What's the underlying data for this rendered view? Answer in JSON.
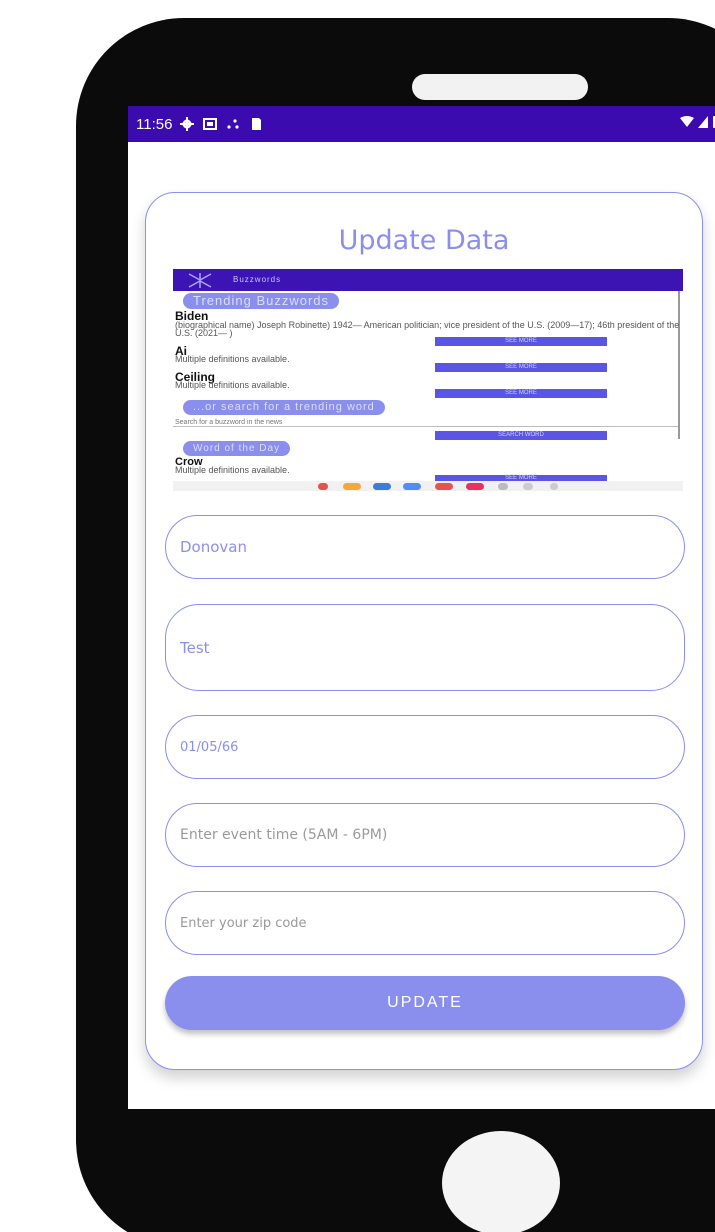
{
  "status_bar": {
    "time": "11:56",
    "left_icons": [
      "settings-icon",
      "mail-icon",
      "signal-dots-icon",
      "sd-card-icon"
    ],
    "right_icons": [
      "wifi-icon",
      "cell-signal-icon",
      "battery-icon"
    ],
    "background": "#3b0bb0"
  },
  "card": {
    "title": "Update Data",
    "accent": "#8a8fee"
  },
  "preview": {
    "app_title": "Buzzwords",
    "trending_header": "Trending Buzzwords",
    "items": [
      {
        "word": "Biden",
        "def": "(biographical name) Joseph Robinette) 1942— American politician; vice president of the U.S. (2009—17); 46th president of the U.S. (2021— )",
        "button": "SEE MORE"
      },
      {
        "word": "Ai",
        "def": "Multiple definitions available.",
        "button": "SEE MORE"
      },
      {
        "word": "Ceiling",
        "def": "Multiple definitions available.",
        "button": "SEE MORE"
      }
    ],
    "search_header": "...or search for a trending word",
    "search_placeholder": "Search for a buzzword in the news",
    "search_button": "SEARCH WORD",
    "wotd_header": "Word of the Day",
    "wotd": {
      "word": "Crow",
      "def": "Multiple definitions available.",
      "button": "SEE MORE"
    }
  },
  "form": {
    "name_value": "Donovan",
    "event_value": "Test",
    "date_value": "01/05/66",
    "time_placeholder": "Enter event time (5AM - 6PM)",
    "zip_placeholder": "Enter your zip code",
    "update_label": "UPDATE"
  }
}
